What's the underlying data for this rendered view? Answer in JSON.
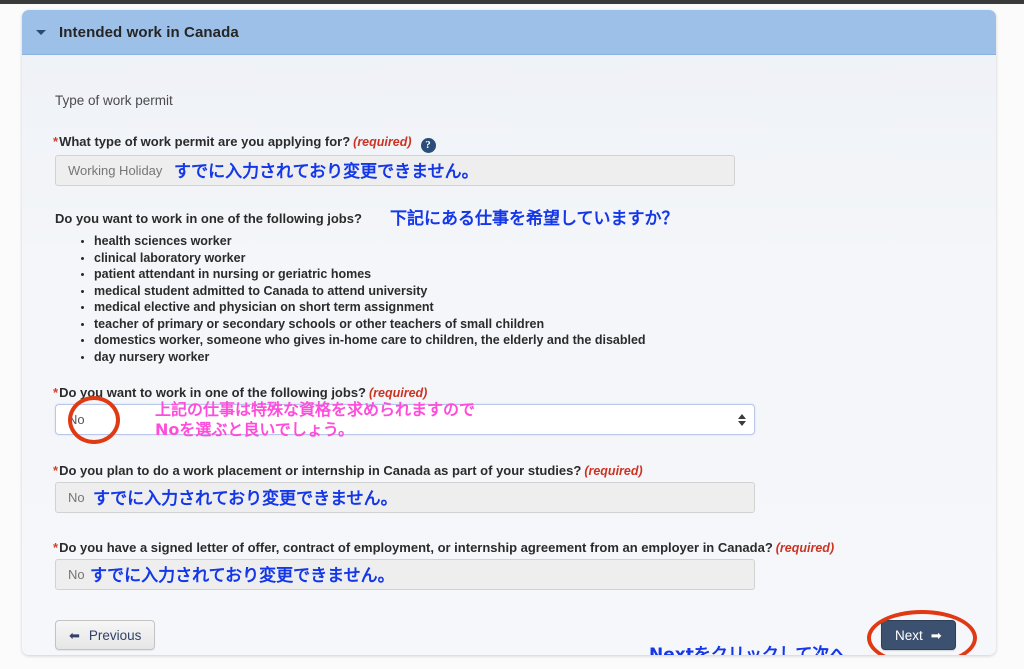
{
  "panel": {
    "title": "Intended work in Canada",
    "caret_icon": "chevron-down-icon"
  },
  "form": {
    "section_label": "Type of work permit",
    "q1": {
      "label": "What type of work permit are you applying for?",
      "required_text": "(required)",
      "help_icon": "question-mark-icon",
      "value": "Working Holiday",
      "annotation": "すでに入力されており変更できません。"
    },
    "intro": {
      "label": "Do you want to work in one of the following jobs?",
      "annotation": "下記にある仕事を希望していますか？"
    },
    "jobs": [
      "health sciences worker",
      "clinical laboratory worker",
      "patient attendant in nursing or geriatric homes",
      "medical student admitted to Canada to attend university",
      "medical elective and physician on short term assignment",
      "teacher of primary or secondary schools or other teachers of small children",
      "domestics worker, someone who gives in-home care to children, the elderly and the disabled",
      "day nursery worker"
    ],
    "q2": {
      "label": "Do you want to work in one of the following jobs?",
      "required_text": "(required)",
      "value": "No",
      "annotation_line1": "上記の仕事は特殊な資格を求められますので",
      "annotation_line2": "Noを選ぶと良いでしょう。"
    },
    "q3": {
      "label": "Do you plan to do a work placement or internship in Canada as part of your studies?",
      "required_text": "(required)",
      "value": "No",
      "annotation": "すでに入力されており変更できません。"
    },
    "q4": {
      "label": "Do you have a signed letter of offer, contract of employment, or internship agreement from an employer in Canada?",
      "required_text": "(required)",
      "value": "No",
      "annotation": "すでに入力されており変更できません。"
    }
  },
  "footer": {
    "previous_label": "Previous",
    "previous_icon": "arrow-left-icon",
    "next_label": "Next",
    "next_icon": "arrow-right-icon",
    "next_annotation": "Nextをクリックして次へ"
  },
  "colors": {
    "header_blue": "#9cc0e7",
    "annotation_blue": "#1437e8",
    "annotation_pink": "#ff4ddb",
    "circle_red": "#e03a14",
    "required_red": "#cc3322",
    "next_navy": "#3c5070"
  }
}
